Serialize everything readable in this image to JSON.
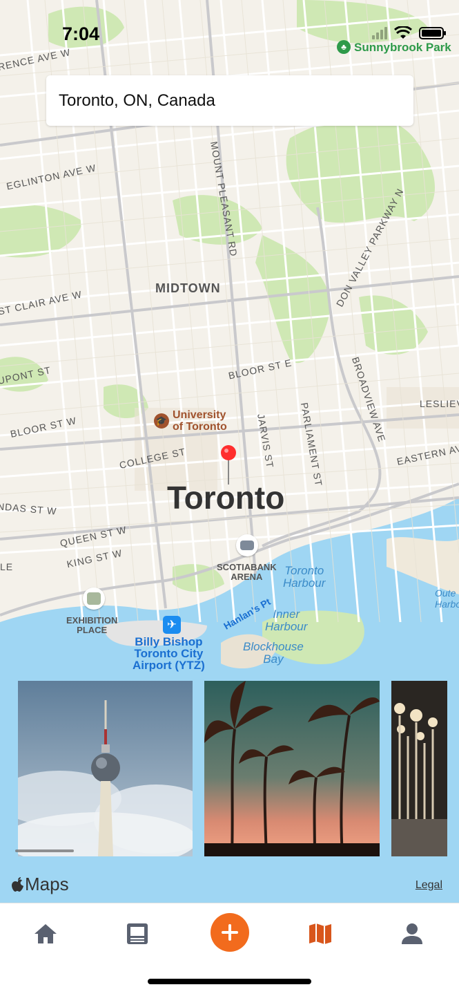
{
  "status_bar": {
    "time": "7:04"
  },
  "search": {
    "value": "Toronto, ON, Canada"
  },
  "map": {
    "city": "Toronto",
    "district": "MIDTOWN",
    "streets": {
      "lawrence": "RENCE AVE W",
      "eglinton": "EGLINTON AVE W",
      "st_clair": "ST CLAIR AVE W",
      "dupont": "UPONT ST",
      "bloor_w": "BLOOR ST W",
      "bloor_e": "BLOOR ST E",
      "college": "COLLEGE ST",
      "dundas": "NDAS ST W",
      "queen": "QUEEN ST W",
      "king": "KING ST W",
      "mount_pleasant": "MOUNT PLEASANT RD",
      "jarvis": "JARVIS ST",
      "parliament": "PARLIAMENT ST",
      "don_valley": "DON VALLEY PARKWAY N",
      "broadview": "BROADVIEW AVE",
      "eastern": "EASTERN AV",
      "leslie": "LESLIEV",
      "edge_e": "LE"
    },
    "pois": {
      "sunnybrook": "Sunnybrook Park",
      "university_line1": "University",
      "university_line2": "of Toronto",
      "scotiabank_line1": "SCOTIABANK",
      "scotiabank_line2": "ARENA",
      "exhibition_line1": "EXHIBITION",
      "exhibition_line2": "PLACE",
      "airport_line1": "Billy Bishop",
      "airport_line2": "Toronto City",
      "airport_line3": "Airport (YTZ)"
    },
    "water": {
      "harbour_line1": "Toronto",
      "harbour_line2": "Harbour",
      "inner_line1": "Inner",
      "inner_line2": "Harbour",
      "blockhouse_line1": "Blockhouse",
      "blockhouse_line2": "Bay",
      "hanlans": "Hanlan's Pt",
      "outer_line1": "Oute",
      "outer_line2": "Harbo"
    },
    "attribution": "Maps",
    "legal": "Legal"
  },
  "photos": [
    {
      "subject": "tv-tower-against-cloudy-sky"
    },
    {
      "subject": "palm-trees-at-sunset"
    },
    {
      "subject": "street-lamps-installation"
    }
  ],
  "tab_bar": {
    "items": [
      "home-icon",
      "feed-icon",
      "add-icon",
      "map-icon",
      "profile-icon"
    ],
    "active": "map-icon",
    "accent": "#f26b1d",
    "inactive": "#5a6170"
  }
}
